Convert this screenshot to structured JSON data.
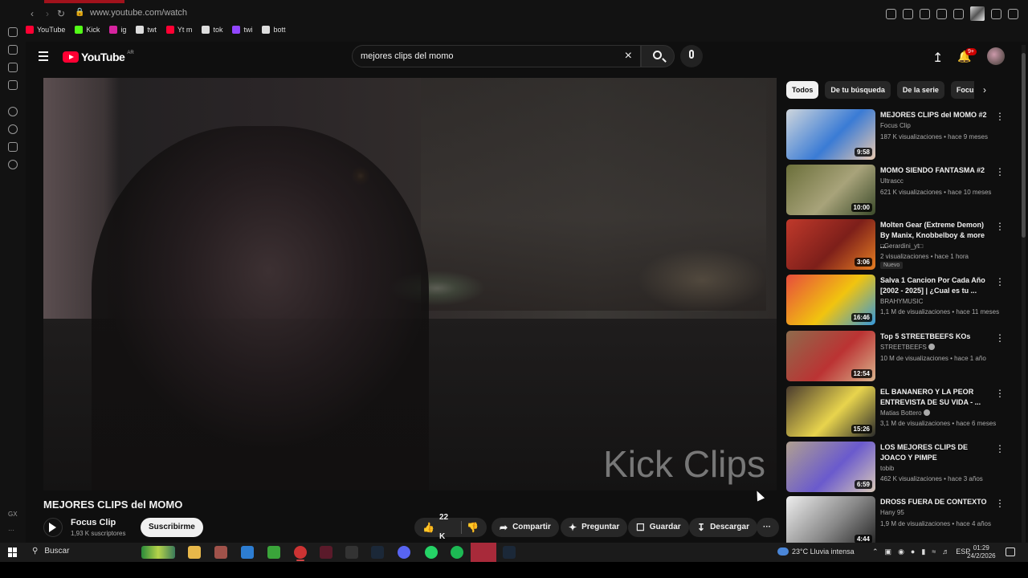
{
  "browser": {
    "url": "www.youtube.com/watch",
    "bookmarks": [
      {
        "label": "YouTube",
        "color": "#ff0033"
      },
      {
        "label": "Kick",
        "color": "#53fc18"
      },
      {
        "label": "ig",
        "color": "#d6249f"
      },
      {
        "label": "twt",
        "color": "#dddddd"
      },
      {
        "label": "Yt m",
        "color": "#ff0033"
      },
      {
        "label": "tok",
        "color": "#dddddd"
      },
      {
        "label": "twi",
        "color": "#9146ff"
      },
      {
        "label": "bott",
        "color": "#dddddd"
      }
    ],
    "side_label": "GX"
  },
  "header": {
    "logo_word": "YouTube",
    "logo_country": "AR",
    "search_value": "mejores clips del momo",
    "notif_badge": "9+"
  },
  "video": {
    "watermark": "Kick Clips",
    "title": "MEJORES CLIPS del MOMO",
    "channel": "Focus Clip",
    "subscribers": "1,93 K suscriptores",
    "subscribe_label": "Suscribirme",
    "likes": "22 K",
    "share_label": "Compartir",
    "ask_label": "Preguntar",
    "save_label": "Guardar",
    "download_label": "Descargar"
  },
  "chips": [
    "Todos",
    "De tu búsqueda",
    "De la serie",
    "Focus"
  ],
  "recommendations": [
    {
      "title": "MEJORES CLIPS del MOMO #2",
      "channel": "Focus Clip",
      "meta": "187 K visualizaciones • hace 9 meses",
      "duration": "9:58",
      "colors": [
        "#cfd6dc",
        "#3a7bd5",
        "#e8c9b0"
      ]
    },
    {
      "title": "MOMO SIENDO FANTASMA #2",
      "channel": "Ultrascc",
      "meta": "621 K visualizaciones • hace 10 meses",
      "duration": "10:00",
      "colors": [
        "#6b6f3a",
        "#a8a37a",
        "#3b4a2a"
      ]
    },
    {
      "title": "Molten Gear (Extreme Demon) By Manix, Knobbelboy & more ...",
      "channel": "□Gerardini_yt□",
      "meta": "2 visualizaciones • hace 1 hora",
      "duration": "3:06",
      "badge": "Nuevo",
      "colors": [
        "#c0392b",
        "#7d1f1a",
        "#e67e22"
      ]
    },
    {
      "title": "Salva 1 Cancion Por Cada Año [2002 - 2025] | ¿Cual es tu ...",
      "channel": "BRAHYMUSIC",
      "meta": "1,1 M de visualizaciones • hace 11 meses",
      "duration": "16:46",
      "colors": [
        "#e74c3c",
        "#f1c40f",
        "#3498db"
      ]
    },
    {
      "title": "Top 5 STREETBEEFS KOs",
      "channel": "STREETBEEFS",
      "verified": true,
      "meta": "10 M de visualizaciones • hace 1 año",
      "duration": "12:54",
      "colors": [
        "#8e6b4c",
        "#b33",
        "#d9b38c"
      ]
    },
    {
      "title": "EL BANANERO Y LA PEOR ENTREVISTA DE SU VIDA - ...",
      "channel": "Matias Bottero",
      "verified": true,
      "meta": "3,1 M de visualizaciones • hace 6 meses",
      "duration": "15:26",
      "colors": [
        "#4a3b2e",
        "#e8d44d",
        "#2c2c2c"
      ]
    },
    {
      "title": "LOS MEJORES CLIPS DE JOACO Y PIMPE",
      "channel": "tobib",
      "meta": "462 K visualizaciones • hace 3 años",
      "duration": "6:59",
      "colors": [
        "#b0a090",
        "#6a5acd",
        "#d8c8b8"
      ]
    },
    {
      "title": "DROSS FUERA DE CONTEXTO",
      "channel": "Hany 95",
      "meta": "1,9 M de visualizaciones • hace 4 años",
      "duration": "4:44",
      "colors": [
        "#eeeeee",
        "#888888",
        "#222222"
      ]
    }
  ],
  "taskbar": {
    "search_label": "Buscar",
    "weather": "23°C  Lluvia intensa",
    "lang": "ESP",
    "time": "01:29",
    "date": "24/2/2026"
  }
}
